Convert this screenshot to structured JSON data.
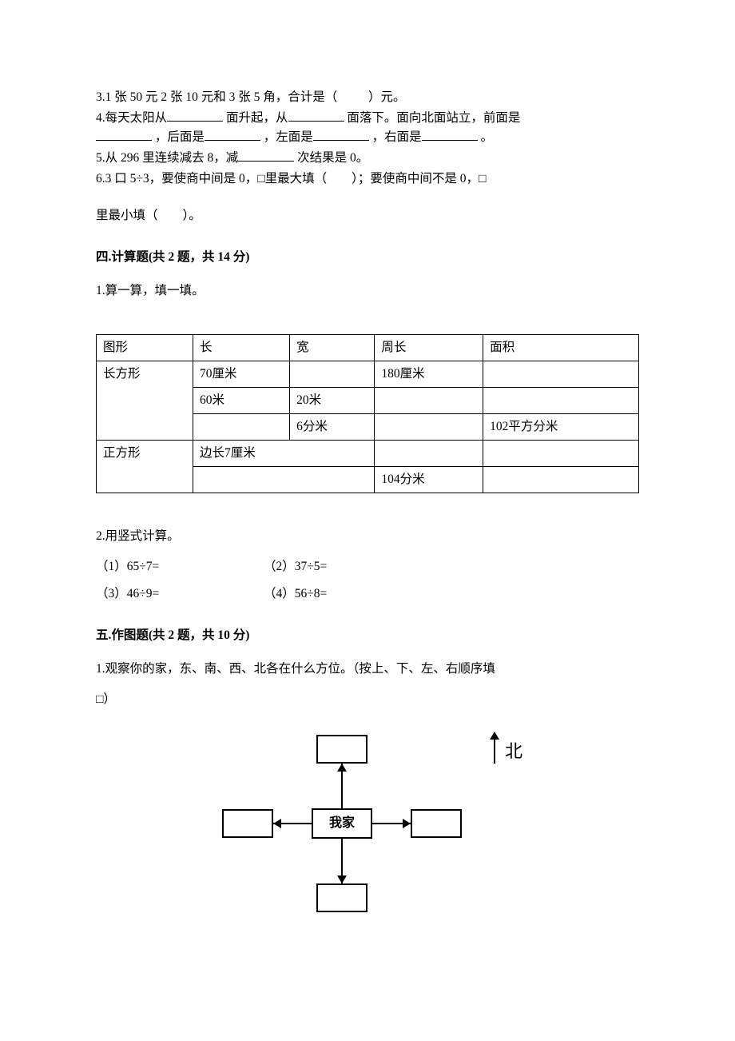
{
  "q3": {
    "prefix": "3.1 张 50 元 2 张 10 元和 3 张 5 角，合计是（",
    "suffix": "）元。"
  },
  "q4": {
    "a": "4.每天太阳从",
    "b": "面升起，从",
    "c": "面落下。面向北面站立，前面是",
    "d": "，后面是",
    "e": "，左面是",
    "f": "，右面是",
    "g": "。"
  },
  "q5": {
    "a": "5.从 296 里连续减去 8，减",
    "b": "次结果是 0。"
  },
  "q6": {
    "line1": "6.3 口 5÷3，要使商中间是 0，□里最大填（　　）；要使商中间不是 0，□",
    "line2": "里最小填（　　）。"
  },
  "sec4": {
    "heading": "四.计算题(共 2 题，共 14 分)",
    "item1": "1.算一算，填一填。",
    "table": {
      "headers": [
        "图形",
        "长",
        "宽",
        "周长",
        "面积"
      ],
      "rows": [
        [
          "长方形",
          "70厘米",
          "",
          "180厘米",
          ""
        ],
        [
          "",
          "60米",
          "20米",
          "",
          ""
        ],
        [
          "",
          "",
          "6分米",
          "",
          "102平方分米"
        ],
        [
          "正方形",
          "边长7厘米_span",
          "",
          "",
          ""
        ],
        [
          "",
          "",
          "",
          "104分米",
          ""
        ]
      ]
    },
    "item2": "2.用竖式计算。",
    "calc": [
      [
        "（1）65÷7=",
        "（2）37÷5="
      ],
      [
        "（3）46÷9=",
        "（4）56÷8="
      ]
    ]
  },
  "sec5": {
    "heading": "五.作图题(共 2 题，共 10 分)",
    "item1a": "1.观察你的家，东、南、西、北各在什么方位。（按上、下、左、右顺序填",
    "item1b": "□）",
    "center": "我家",
    "north": "北"
  }
}
